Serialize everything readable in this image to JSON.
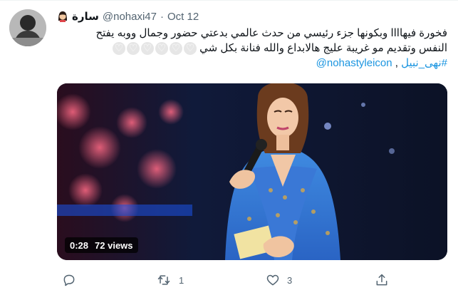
{
  "tweet": {
    "author": {
      "display_name": "سارة",
      "handle": "@nohaxi47",
      "separator": "·",
      "date": "Oct 12",
      "name_emoji": "woman-emoji"
    },
    "body": {
      "line1": "فخورة فيهاااا وبكونها جزء رئيسي من حدث عالمي بدعتي حضور وجمال ووبه يفتح",
      "line2": "النفس وتقديم مو غريبة عليج هالابداع والله فنانة بكل شي",
      "hearts": [
        "white-heart-emoji",
        "white-heart-emoji",
        "white-heart-emoji",
        "white-heart-emoji",
        "white-heart-emoji",
        "white-heart-emoji"
      ],
      "hashtag": "#نهى_نبيل",
      "tag_separator": " , ",
      "mention": "@nohastyleicon"
    },
    "media": {
      "elapsed": "0:28",
      "views": "72 views"
    },
    "actions": {
      "reply_count": "",
      "retweet_count": "1",
      "like_count": "3",
      "share_count": ""
    },
    "colors": {
      "link": "#1b95e0",
      "muted": "#536471",
      "text": "#0f1419"
    }
  }
}
